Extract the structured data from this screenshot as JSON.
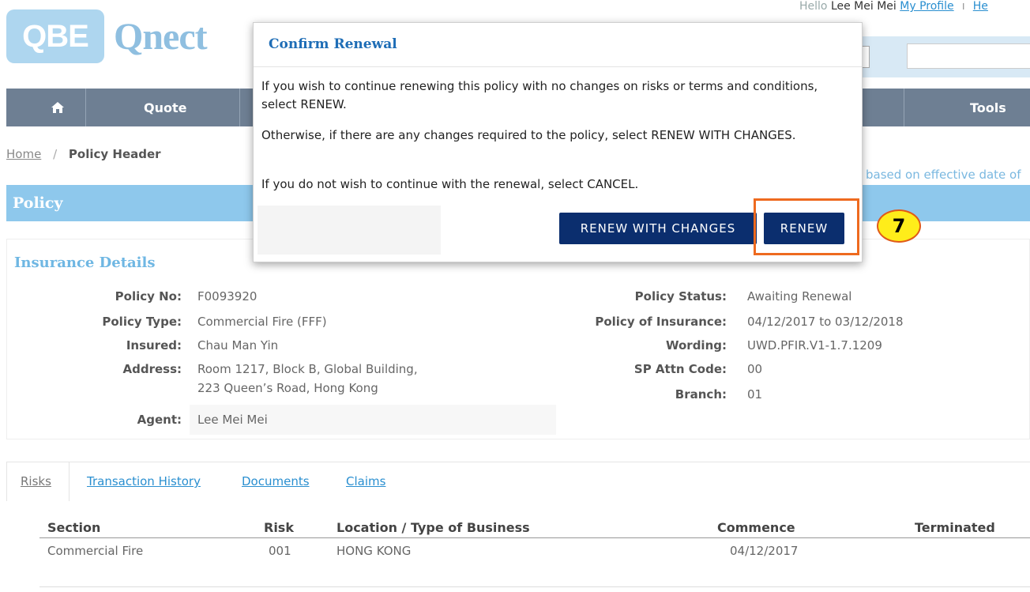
{
  "logo": {
    "brand": "QBE",
    "product": "Qnect"
  },
  "user_bar": {
    "greeting": "Hello",
    "user_name": "Lee Mei Mei",
    "my_profile": "My Profile",
    "separator": "I",
    "truncated_link": "He"
  },
  "nav": {
    "home_icon": "home-icon",
    "items": [
      {
        "label": "Quote"
      },
      {
        "label": "Tools"
      }
    ]
  },
  "breadcrumb": {
    "home": "Home",
    "separator": "/",
    "current": "Policy Header"
  },
  "effective_note": "based on effective date of",
  "policy_band": {
    "title": "Policy"
  },
  "insurance_details": {
    "title": "Insurance Details",
    "left": [
      {
        "label": "Policy No:",
        "value": "F0093920"
      },
      {
        "label": "Policy Type:",
        "value": "Commercial Fire (FFF)"
      },
      {
        "label": "Insured:",
        "value": "Chau Man Yin"
      },
      {
        "label": "Address:",
        "value": "Room 1217, Block B, Global Building,",
        "value2": "223 Queen’s Road, Hong Kong"
      },
      {
        "label": "Agent:",
        "value": "Lee Mei Mei"
      }
    ],
    "right": [
      {
        "label": "Policy Status:",
        "value": "Awaiting Renewal"
      },
      {
        "label": "Policy of Insurance:",
        "value": "04/12/2017 to 03/12/2018"
      },
      {
        "label": "Wording:",
        "value": "UWD.PFIR.V1-1.7.1209"
      },
      {
        "label": "SP Attn Code:",
        "value": "00"
      },
      {
        "label": "Branch:",
        "value": "01"
      }
    ]
  },
  "tabs": [
    {
      "label": "Risks",
      "active": true
    },
    {
      "label": "Transaction History",
      "active": false
    },
    {
      "label": "Documents",
      "active": false
    },
    {
      "label": "Claims",
      "active": false
    }
  ],
  "risk_table": {
    "headers": [
      "Section",
      "Risk",
      "Location / Type of Business",
      "Commence",
      "Terminated"
    ],
    "rows": [
      [
        "Commercial Fire",
        "001",
        "HONG KONG",
        "04/12/2017",
        ""
      ]
    ]
  },
  "modal": {
    "title": "Confirm Renewal",
    "paragraphs": [
      "If you wish to continue renewing this policy with no changes on risks or terms and conditions, select RENEW.",
      "Otherwise, if there are any changes required to the policy, select RENEW WITH CHANGES.",
      "If you do not wish to continue with the renewal, select CANCEL."
    ],
    "buttons": {
      "renew_with_changes": "RENEW WITH CHANGES",
      "renew": "RENEW"
    }
  },
  "annotation": {
    "step_number": "7",
    "highlight_color": "#ee6a1f",
    "badge_color": "#ffed1a"
  },
  "colors": {
    "nav": "#6e7f93",
    "policy_band": "#8ec8ec",
    "button": "#0b2e6e",
    "link": "#2a8fd0"
  }
}
